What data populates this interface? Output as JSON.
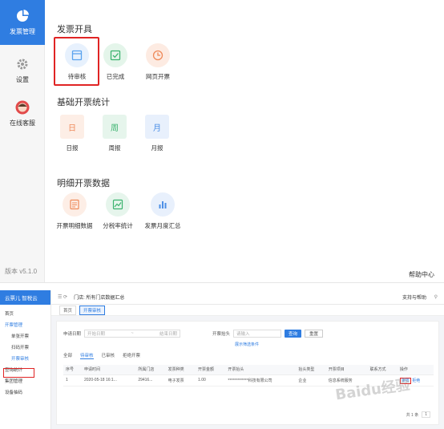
{
  "top": {
    "rail": [
      {
        "label": "发票管理",
        "icon": "pie-chart-icon",
        "active": true
      },
      {
        "label": "设置",
        "icon": "gear-icon",
        "active": false
      },
      {
        "label": "在线客服",
        "icon": "customer-service-avatar-icon",
        "active": false
      }
    ],
    "version": "版本 v5.1.0",
    "help": "帮助中心",
    "sections": {
      "issue": {
        "title": "发票开具",
        "tiles": [
          {
            "label": "待审核",
            "icon": "pending-review-icon",
            "color": "#5aa3ef",
            "bg": "#e7f1fd"
          },
          {
            "label": "已完成",
            "icon": "check-icon",
            "color": "#3bb36e",
            "bg": "#e4f5ea"
          },
          {
            "label": "网页开票",
            "icon": "clock-icon",
            "color": "#ef8a5a",
            "bg": "#fdebe2"
          }
        ]
      },
      "stats": {
        "title": "基础开票统计",
        "tiles": [
          {
            "label": "日报",
            "glyph": "日",
            "color": "#ef8a5a",
            "bg": "#fdeee6"
          },
          {
            "label": "周报",
            "glyph": "周",
            "color": "#3bb36e",
            "bg": "#e6f5ec"
          },
          {
            "label": "月报",
            "glyph": "月",
            "color": "#4d8fe6",
            "bg": "#e8f0fc"
          }
        ]
      },
      "detail": {
        "title": "明细开票数据",
        "tiles": [
          {
            "label": "开票明细数据",
            "icon": "list-document-icon",
            "color": "#ef8a5a",
            "bg": "#fdeee6"
          },
          {
            "label": "分税率统计",
            "icon": "image-chart-icon",
            "color": "#3bb36e",
            "bg": "#e6f5ec"
          },
          {
            "label": "发票月度汇总",
            "icon": "bar-chart-icon",
            "color": "#4d8fe6",
            "bg": "#e8f0fc"
          }
        ]
      }
    }
  },
  "bottom": {
    "logo": "云票儿 智税云",
    "menu": [
      {
        "label": "首页",
        "sub": false
      },
      {
        "label": "开票管理",
        "sub": false,
        "selected": true
      },
      {
        "label": "单张开票",
        "sub": true
      },
      {
        "label": "扫码开票",
        "sub": true
      },
      {
        "label": "开票审核",
        "sub": true,
        "selected": true
      },
      {
        "label": "查询统计",
        "sub": false
      },
      {
        "label": "集团管理",
        "sub": false
      },
      {
        "label": "设备抽码",
        "sub": false
      }
    ],
    "breadcrumb": "门店: 所有门店数据汇总",
    "topbar_right": "支持与帮助",
    "tabs": [
      "首页",
      "开票审核"
    ],
    "filter": {
      "label_date": "申请日期",
      "date_start": "开始日期",
      "date_sep": "~",
      "date_end": "结束日期",
      "label_head": "开票抬头",
      "head_placeholder": "请输入",
      "search": "查询",
      "reset": "重置",
      "more": "展示筛选条件"
    },
    "subtabs": [
      "全部",
      "待审核",
      "已审核",
      "拒绝开票"
    ],
    "table": {
      "headers": [
        "序号",
        "申请时间",
        "所属门店",
        "发票种类",
        "开票金额",
        "开票抬头",
        "抬头类型",
        "开票项目",
        "联系方式",
        "操作"
      ],
      "rows": [
        [
          "1",
          "2020-05-18 16:1...",
          "29416...",
          "电子发票",
          "1.00",
          "*************科技有限公司",
          "企业",
          "信息系统服务",
          "",
          "审核"
        ]
      ],
      "reject": "拒绝"
    },
    "pager": {
      "total": "共 1 条",
      "page": "1"
    },
    "watermark": "Baidu经验"
  }
}
